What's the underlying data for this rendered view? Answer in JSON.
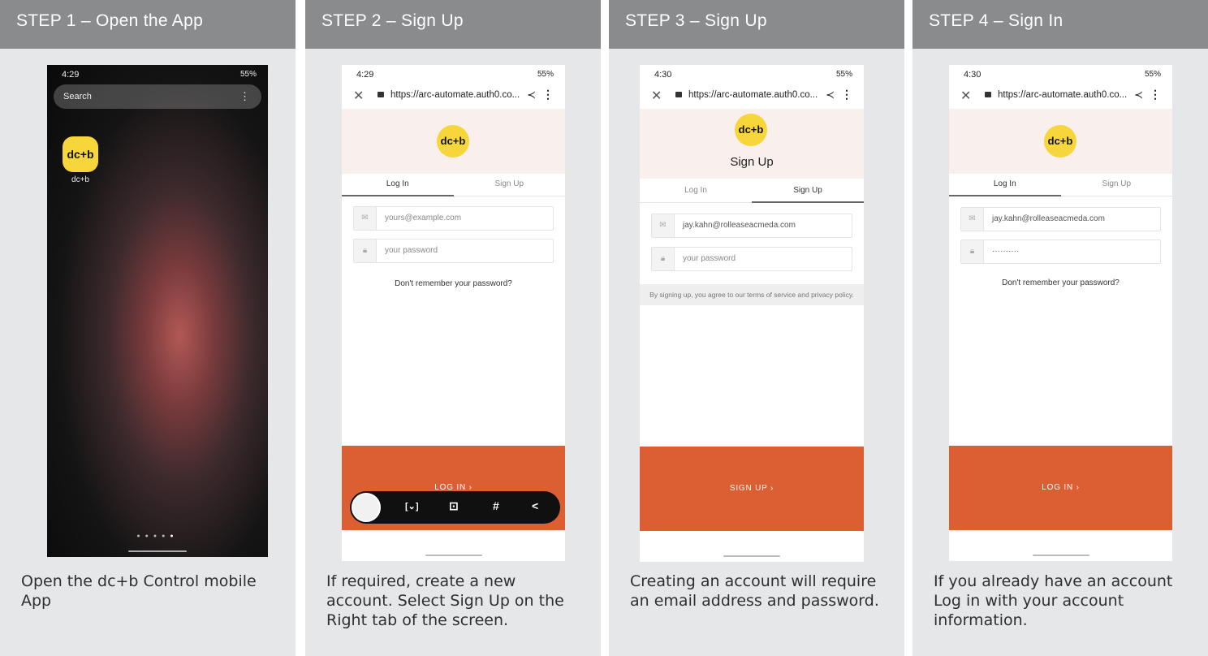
{
  "steps": [
    {
      "title": "STEP 1 – Open the App",
      "caption": "Open the dc+b Control mobile App"
    },
    {
      "title": "STEP 2 – Sign Up",
      "caption": "If required, create a new account. Select Sign Up on the Right tab of the screen."
    },
    {
      "title": "STEP 3 – Sign Up",
      "caption": "Creating an account will require an email address and password."
    },
    {
      "title": "STEP 4 – Sign In",
      "caption": "If you already have an account Log in with your account information."
    }
  ],
  "home_screen": {
    "time": "4:29",
    "status_right": "55%",
    "search_label": "Search",
    "app_logo": "dc+b",
    "app_label": "dc+b"
  },
  "screen2": {
    "time": "4:29",
    "status_right": "55%",
    "url": "https://arc-automate.auth0.co...",
    "logo": "dc+b",
    "tabs": [
      "Log In",
      "Sign Up"
    ],
    "email_placeholder": "yours@example.com",
    "password_placeholder": "your password",
    "forgot": "Don't remember your password?",
    "cta": "LOG IN ›",
    "toolbar_icons": [
      "screenshot-thumbnail-icon",
      "scroll-capture-icon",
      "crop-edit-icon",
      "hashtag-icon",
      "share-icon"
    ]
  },
  "screen3": {
    "time": "4:30",
    "status_right": "55%",
    "url": "https://arc-automate.auth0.co...",
    "logo": "dc+b",
    "heading": "Sign Up",
    "tabs": [
      "Log In",
      "Sign Up"
    ],
    "email_value": "jay.kahn@rolleaseacmeda.com",
    "password_placeholder": "your password",
    "terms": "By signing up, you agree to our terms of service and privacy policy.",
    "cta": "SIGN UP ›"
  },
  "screen4": {
    "time": "4:30",
    "status_right": "55%",
    "url": "https://arc-automate.auth0.co...",
    "logo": "dc+b",
    "tabs": [
      "Log In",
      "Sign Up"
    ],
    "email_value": "jay.kahn@rolleaseacmeda.com",
    "password_value": "··········",
    "forgot": "Don't remember your password?",
    "cta": "LOG IN ›"
  },
  "colors": {
    "header": "#8a8b8d",
    "panel": "#e6e7e9",
    "cta": "#db5f33",
    "logo": "#f6d63a",
    "hero": "#f9efec"
  }
}
